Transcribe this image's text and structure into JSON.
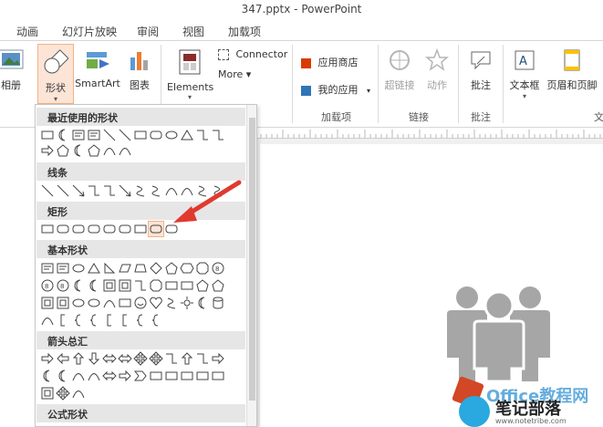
{
  "window": {
    "title": "347.pptx - PowerPoint"
  },
  "tabs": [
    "动画",
    "幻灯片放映",
    "审阅",
    "视图",
    "加载项"
  ],
  "ribbon": {
    "album": "相册",
    "shapes": "形状",
    "smartart": "SmartArt",
    "chart": "图表",
    "elements": "Elements",
    "connector": "Connector",
    "more": "More ▾",
    "store": "应用商店",
    "myapps": "我的应用",
    "addins_group": "加载项",
    "hyperlink": "超链接",
    "action": "动作",
    "link_group": "链接",
    "comment": "批注",
    "comment_group": "批注",
    "textbox": "文本框",
    "header_footer": "页眉和页脚",
    "text_group_partial": "文"
  },
  "dropdown": {
    "sections": {
      "recent": "最近使用的形状",
      "lines": "线条",
      "rect": "矩形",
      "basic": "基本形状",
      "arrows": "箭头总汇",
      "equation": "公式形状"
    }
  },
  "watermark": {
    "brand": "Office教程网",
    "site": "笔记部落",
    "url": "www.notetribe.com"
  },
  "colors": {
    "accent": "#d24726",
    "arrow": "#e03a2f",
    "people": "#a6a6a6"
  }
}
